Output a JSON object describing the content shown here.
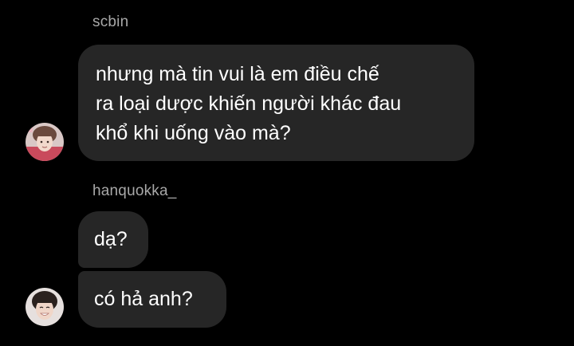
{
  "chat": {
    "groups": [
      {
        "sender": "scbin",
        "messages": [
          {
            "lines": [
              "nhưng mà tin vui là em điều chế",
              "ra loại dược khiến người khác đau",
              "khổ khi uống vào mà?"
            ]
          }
        ]
      },
      {
        "sender": "hanquokka_",
        "messages": [
          {
            "lines": [
              "dạ?"
            ]
          },
          {
            "lines": [
              "có hả anh?"
            ]
          }
        ]
      }
    ]
  },
  "colors": {
    "background": "#000000",
    "bubble": "#262626",
    "sender_text": "#a8a8a8",
    "message_text": "#ffffff"
  }
}
